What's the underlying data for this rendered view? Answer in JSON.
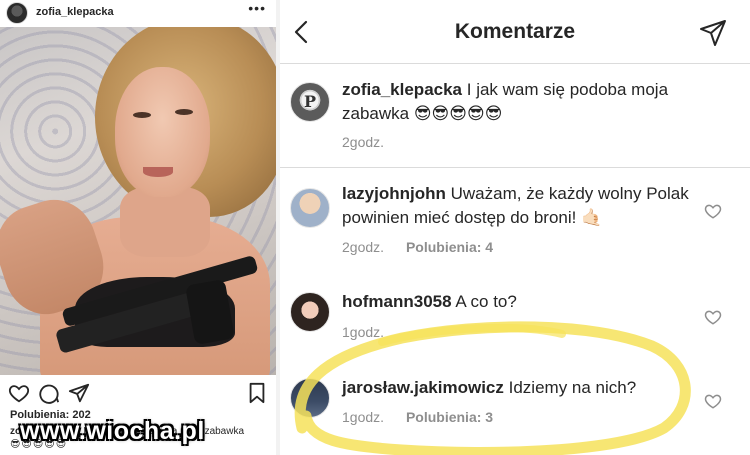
{
  "post": {
    "username": "zofia_klepacka",
    "more_label": "•••",
    "likes_text": "Polubienia: 202",
    "caption_user": "zofia_klepacka",
    "caption_text": "I jak wam się podoba moja zabawka",
    "caption_emoji": "😎😎😎😎😎",
    "watermark": "www.wiocha.pl"
  },
  "header": {
    "title": "Komentarze"
  },
  "caption_comment": {
    "username": "zofia_klepacka",
    "text": "I jak wam się podoba moja zabawka 😎😎😎😎😎",
    "time": "2godz."
  },
  "comments": [
    {
      "username": "lazyjohnjohn",
      "text": "Uważam, że każdy wolny Polak powinien mieć dostęp do broni! 🤙🏻",
      "time": "2godz.",
      "likes": "Polubienia: 4"
    },
    {
      "username": "hofmann3058",
      "text": "A co to?",
      "time": "1godz.",
      "likes": ""
    },
    {
      "username": "jarosław.jakimowicz",
      "text": "Idziemy na nich?",
      "time": "1godz.",
      "likes": "Polubienia: 3"
    }
  ],
  "colors": {
    "text": "#262626",
    "muted": "#8e8e8e",
    "divider": "#dbdbdb",
    "highlight": "#f6e25a"
  }
}
